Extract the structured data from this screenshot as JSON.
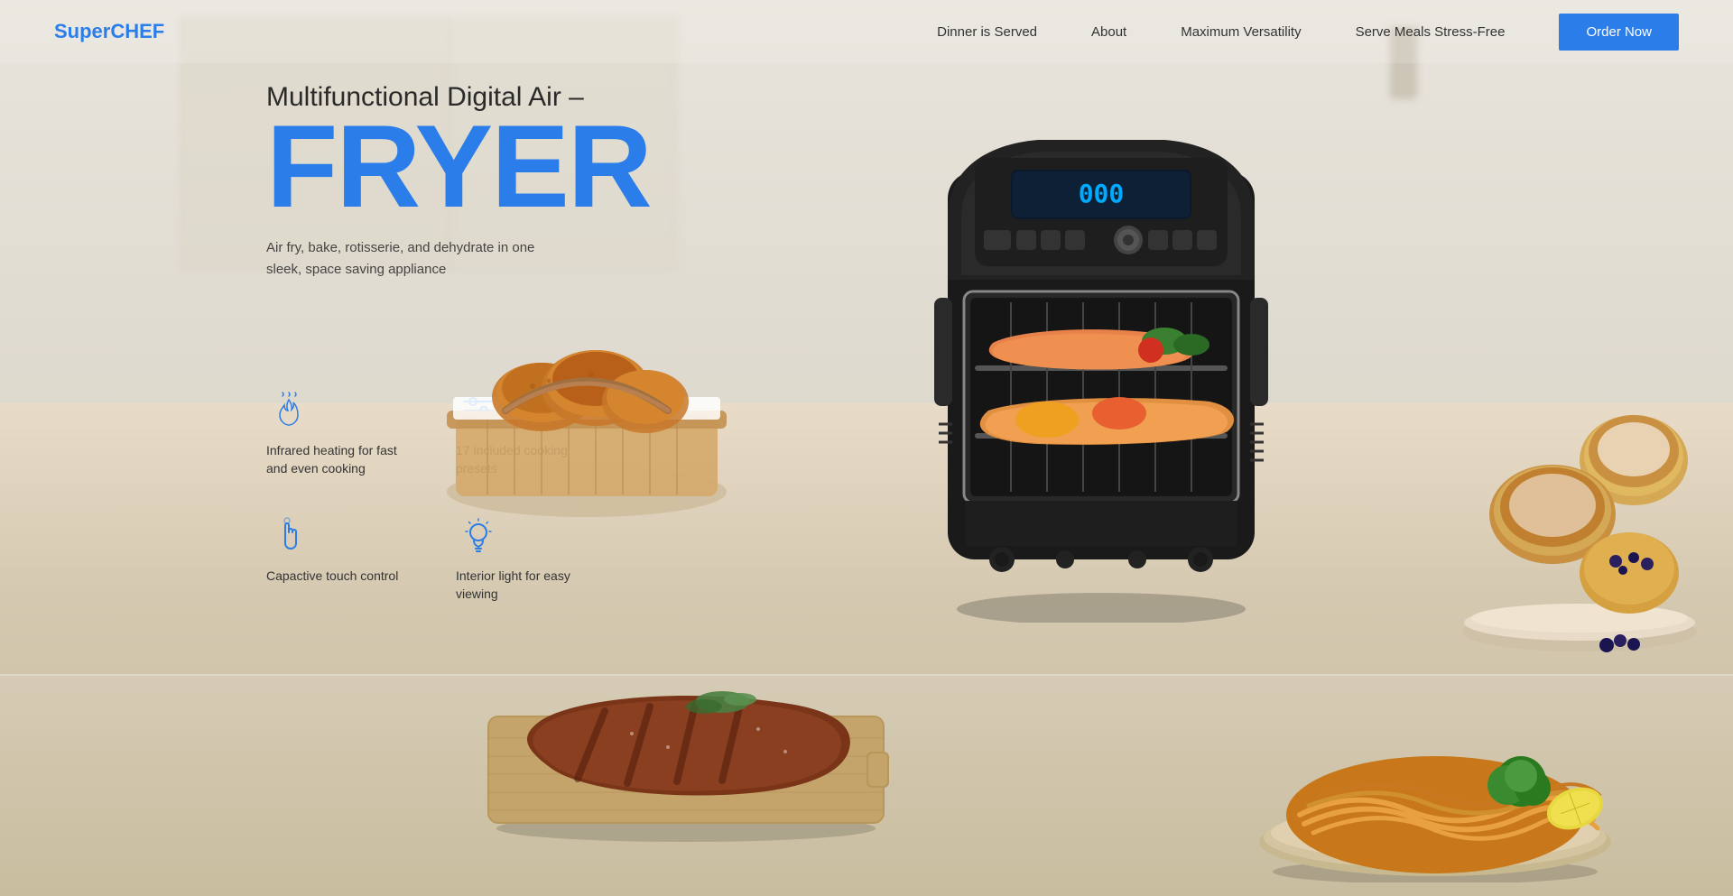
{
  "brand": {
    "name_regular": "Super",
    "name_bold": "CHEF"
  },
  "navbar": {
    "logo": "SuperCHEF",
    "links": [
      {
        "label": "Dinner is Served",
        "id": "dinner"
      },
      {
        "label": "About",
        "id": "about"
      },
      {
        "label": "Maximum Versatility",
        "id": "versatility"
      },
      {
        "label": "Serve Meals Stress-Free",
        "id": "stress-free"
      }
    ],
    "cta": "Order Now"
  },
  "hero": {
    "subtitle": "Multifunctional Digital Air –",
    "title": "FRYER",
    "description": "Air fry, bake, rotisserie, and dehydrate in one sleek, space saving appliance"
  },
  "features": [
    {
      "id": "infrared",
      "icon": "flame-icon",
      "text": "Infrared heating for fast and even cooking"
    },
    {
      "id": "presets",
      "icon": "sliders-icon",
      "text": "17 included cooking presets"
    },
    {
      "id": "touch",
      "icon": "touch-icon",
      "text": "Capactive touch control"
    },
    {
      "id": "light",
      "icon": "bulb-icon",
      "text": "Interior light for easy viewing"
    }
  ],
  "colors": {
    "accent": "#2b7de9",
    "text_dark": "#2a2a2a",
    "text_medium": "#444444",
    "text_light": "#666666",
    "bg_light": "#f5f0e8"
  }
}
